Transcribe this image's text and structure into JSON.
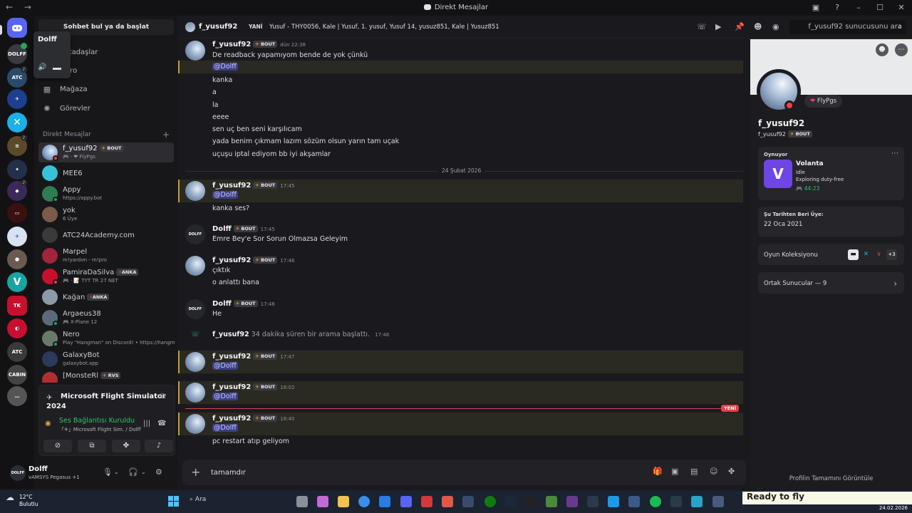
{
  "window": {
    "title": "Direkt Mesajlar",
    "nav_arrows": "← →"
  },
  "tooltip": {
    "name": "Dolff"
  },
  "sidebar": {
    "search_button": "Sohbet bul ya da başlat",
    "nav": [
      {
        "label": "Arkadaşlar",
        "icon": "friends-icon"
      },
      {
        "label": "Nitro",
        "icon": "nitro-icon"
      },
      {
        "label": "Mağaza",
        "icon": "shop-icon"
      },
      {
        "label": "Görevler",
        "icon": "quests-icon"
      }
    ],
    "dm_header": "Direkt Mesajlar",
    "dms": [
      {
        "name": "f_yusuf92",
        "tag": "BOUT",
        "sub": "🎮 · ❤ FlyPgs",
        "color": "#8aa6c8",
        "status": "#f23f43"
      },
      {
        "name": "MEE6",
        "sub": "",
        "color": "#35c3d8",
        "status": ""
      },
      {
        "name": "Appy",
        "sub": "https://appy.bot",
        "color": "#2e7d4f",
        "status": "#23a55a"
      },
      {
        "name": "yok",
        "sub": "6 Üye",
        "color": "#7a5a4a",
        "status": ""
      },
      {
        "name": "ATC24Academy.com",
        "sub": "",
        "color": "#3a3a3a",
        "status": ""
      },
      {
        "name": "Marpel",
        "sub": "m!yardım - m!pro",
        "color": "#a0243a",
        "status": ""
      },
      {
        "name": "PamiraDaSilva",
        "tag": "ANKA",
        "sub": "🎮 · 📝 TYT TR 27 NET",
        "color": "#c8102e",
        "status": "#f23f43"
      },
      {
        "name": "Kağan",
        "tag": "ANKA",
        "sub": "",
        "color": "#8a9aa8",
        "status": ""
      },
      {
        "name": "Argaeus38",
        "sub": "🎮 X-Plane 12",
        "color": "#5a6a7a",
        "status": "#23a55a"
      },
      {
        "name": "Nero",
        "sub": "Play \"Hangman\" on Discord! • https://hangm",
        "color": "#6a7a6a",
        "status": "#23a55a"
      },
      {
        "name": "GalaxyBot",
        "sub": "galaxybot.app",
        "color": "#2a3a5a",
        "status": ""
      },
      {
        "name": "[MonsteRl",
        "tag": "RVS",
        "sub": "",
        "color": "#b03030",
        "status": ""
      }
    ]
  },
  "voice": {
    "game": "Microsoft Flight Simulator 2024",
    "connected": "Ses Bağlantısı Kuruldu",
    "channel": "「✈」Microsoft Flight Sim. / Dolff"
  },
  "user": {
    "name": "Dolff",
    "sub": "vAMSYS Pegasus +1",
    "avatar_text": "DOLFF"
  },
  "chat": {
    "recipient": "f_yusuf92",
    "new_label": "YANİ",
    "topic": "Yusuf - THY0056, Kale | Yusuf, 1. yusuf, Yusuf 14, yusuz851, Kale | Yusuz851",
    "search_placeholder": "f_yusuf92 sunucusunu ara",
    "messages": {
      "m1_name": "f_yusuf92",
      "m1_tag": "BOUT",
      "m1_time": "dün 22:38",
      "m1_l1": "De readback yapamıyom bende de yok çünkü",
      "m1_l2": "@Dolff",
      "m1_l3": "kanka",
      "m1_l4": "a",
      "m1_l5": "la",
      "m1_l6": "eeee",
      "m1_l7": "sen uç ben seni karşılıcam",
      "m1_l8": "yada benim çıkmam lazım sözüm olsun yarın tam uçak",
      "m1_l9": "uçuşu iptal ediyom bb iyi akşamlar",
      "date_divider": "24 Şubat 2026",
      "m2_name": "f_yusuf92",
      "m2_tag": "BOUT",
      "m2_time": "17:45",
      "m2_l1": "@Dolff",
      "m2_l2": "kanka ses?",
      "m3_name": "Dolff",
      "m3_tag": "BOUT",
      "m3_time": "17:45",
      "m3_l1": "Emre Bey'e Sor Sorun Olmazsa Geleyim",
      "m4_name": "f_yusuf92",
      "m4_tag": "BOUT",
      "m4_time": "17:46",
      "m4_l1": "çıktık",
      "m4_l2": "o anlattı bana",
      "m5_name": "Dolff",
      "m5_tag": "BOUT",
      "m5_time": "17:46",
      "m5_l1": "He",
      "call_user": "f_yusuf92",
      "call_text": " 34 dakika süren bir arama başlattı.",
      "call_time": "17:46",
      "m6_name": "f_yusuf92",
      "m6_tag": "BOUT",
      "m6_time": "17:47",
      "m6_l1": "@Dolff",
      "m7_name": "f_yusuf92",
      "m7_tag": "BOUT",
      "m7_time": "18:02",
      "m7_l1": "@Dolff",
      "new_divider": "YENİ",
      "m8_name": "f_yusuf92",
      "m8_tag": "BOUT",
      "m8_time": "18:40",
      "m8_l1": "@Dolff",
      "m8_l2": "pc restart atıp geliyom"
    },
    "composer_value": "tamamdır"
  },
  "profile": {
    "bubble": "FlyPgs",
    "name": "f_yusuf92",
    "username": "f_yusuf92",
    "tag": "BOUT",
    "activity_label": "Oynuyor",
    "game": "Volanta",
    "game_state": "Idle",
    "game_detail": "Exploring duty-free",
    "game_time": "44:23",
    "member_since_label": "Şu Tarihten Beri Üye:",
    "member_since": "22 Oca 2021",
    "collection_label": "Oyun Koleksiyonu",
    "collection_more": "+3",
    "mutual_servers": "Ortak Sunucular — 9",
    "full_profile": "Profilin Tamamını Görüntüle"
  },
  "taskbar": {
    "temp": "12°C",
    "weather": "Bulutlu",
    "search": "Ara",
    "overlay": "Ready to fly",
    "date": "24.02.2026"
  }
}
